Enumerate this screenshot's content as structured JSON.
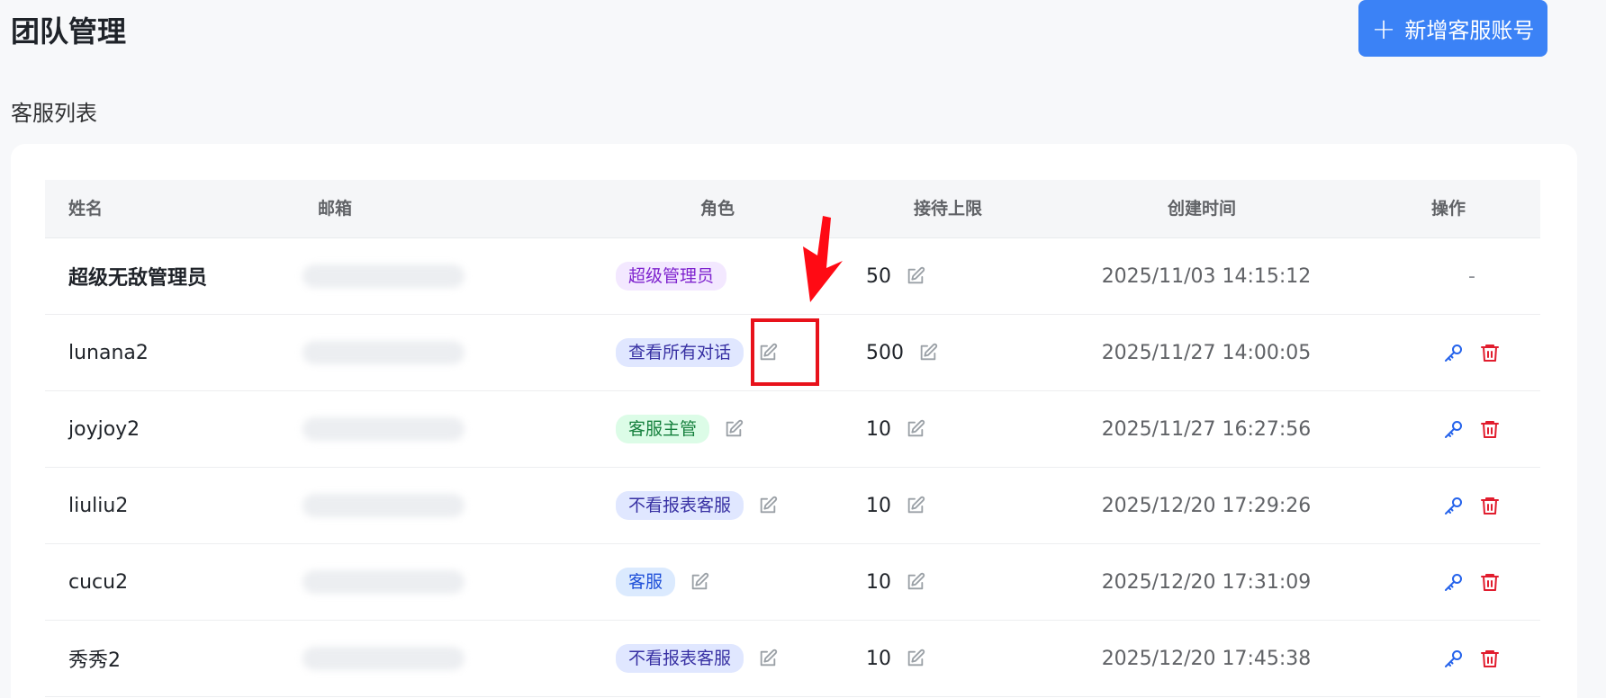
{
  "header": {
    "title": "团队管理",
    "add_button_label": "新增客服账号"
  },
  "section": {
    "title": "客服列表"
  },
  "table": {
    "columns": [
      "姓名",
      "邮箱",
      "角色",
      "接待上限",
      "创建时间",
      "操作"
    ],
    "rows": [
      {
        "name": "超级无敌管理员",
        "role": "超级管理员",
        "limit": "50",
        "created": "2025/11/03 14:15:12",
        "ops": "-"
      },
      {
        "name": "lunana2",
        "role": "查看所有对话",
        "limit": "500",
        "created": "2025/11/27 14:00:05",
        "ops": ""
      },
      {
        "name": "joyjoy2",
        "role": "客服主管",
        "limit": "10",
        "created": "2025/11/27 16:27:56",
        "ops": ""
      },
      {
        "name": "liuliu2",
        "role": "不看报表客服",
        "limit": "10",
        "created": "2025/12/20 17:29:26",
        "ops": ""
      },
      {
        "name": "cucu2",
        "role": "客服",
        "limit": "10",
        "created": "2025/12/20 17:31:09",
        "ops": ""
      },
      {
        "name": "秀秀2",
        "role": "不看报表客服",
        "limit": "10",
        "created": "2025/12/20 17:45:38",
        "ops": ""
      }
    ]
  },
  "colors": {
    "primary": "#3b82f6",
    "danger": "#e11d2e",
    "annotation": "#e8121b"
  }
}
